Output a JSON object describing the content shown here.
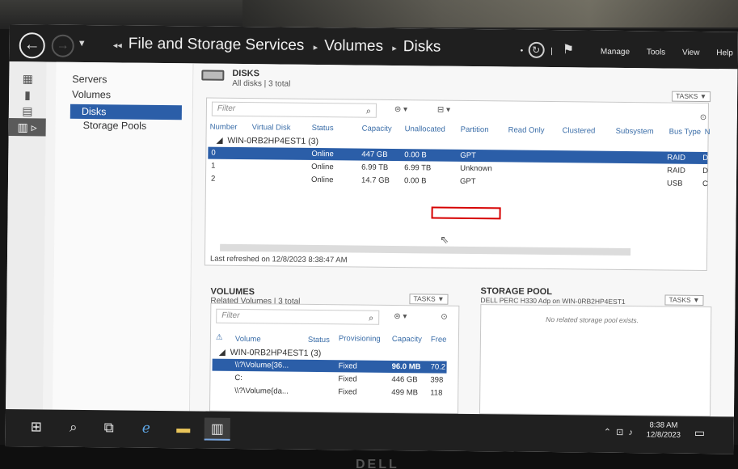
{
  "window": {
    "breadcrumb": [
      "File and Storage Services",
      "Volumes",
      "Disks"
    ],
    "menu": [
      "Manage",
      "Tools",
      "View",
      "Help"
    ]
  },
  "nav": {
    "items": [
      "Servers",
      "Volumes",
      "Disks",
      "Storage Pools"
    ]
  },
  "disks": {
    "title": "DISKS",
    "subtitle": "All disks | 3 total",
    "tasks_label": "TASKS",
    "filter_placeholder": "Filter",
    "columns": [
      "Number",
      "Virtual Disk",
      "Status",
      "Capacity",
      "Unallocated",
      "Partition",
      "Read Only",
      "Clustered",
      "Subsystem",
      "Bus Type",
      "N"
    ],
    "group": "WIN-0RB2HP4EST1 (3)",
    "rows": [
      {
        "number": "0",
        "status": "Online",
        "capacity": "447 GB",
        "unallocated": "0.00 B",
        "partition": "GPT",
        "bus_type": "RAID",
        "extra": "D"
      },
      {
        "number": "1",
        "status": "Online",
        "capacity": "6.99 TB",
        "unallocated": "6.99 TB",
        "partition": "Unknown",
        "bus_type": "RAID",
        "extra": "D"
      },
      {
        "number": "2",
        "status": "Online",
        "capacity": "14.7 GB",
        "unallocated": "0.00 B",
        "partition": "GPT",
        "bus_type": "USB",
        "extra": "C"
      }
    ],
    "last_refreshed": "Last refreshed on 12/8/2023 8:38:47 AM"
  },
  "volumes": {
    "title": "VOLUMES",
    "subtitle": "Related Volumes | 3 total",
    "tasks_label": "TASKS",
    "filter_placeholder": "Filter",
    "columns": [
      "Volume",
      "Status",
      "Provisioning",
      "Capacity",
      "Free"
    ],
    "group": "WIN-0RB2HP4EST1 (3)",
    "rows": [
      {
        "volume": "\\\\?\\Volume{36...",
        "provisioning": "Fixed",
        "capacity": "96.0 MB",
        "free": "70.2"
      },
      {
        "volume": "C:",
        "provisioning": "Fixed",
        "capacity": "446 GB",
        "free": "398"
      },
      {
        "volume": "\\\\?\\Volume{da...",
        "provisioning": "Fixed",
        "capacity": "499 MB",
        "free": "118"
      }
    ]
  },
  "storage_pool": {
    "title": "STORAGE POOL",
    "subtitle": "DELL PERC H330 Adp on WIN-0RB2HP4EST1",
    "tasks_label": "TASKS",
    "empty_message": "No related storage pool exists."
  },
  "taskbar": {
    "time": "8:38 AM",
    "date": "12/8/2023"
  },
  "monitor_brand": "DELL",
  "colors": {
    "selection": "#2b5ea8",
    "highlight_box": "#d60000"
  }
}
